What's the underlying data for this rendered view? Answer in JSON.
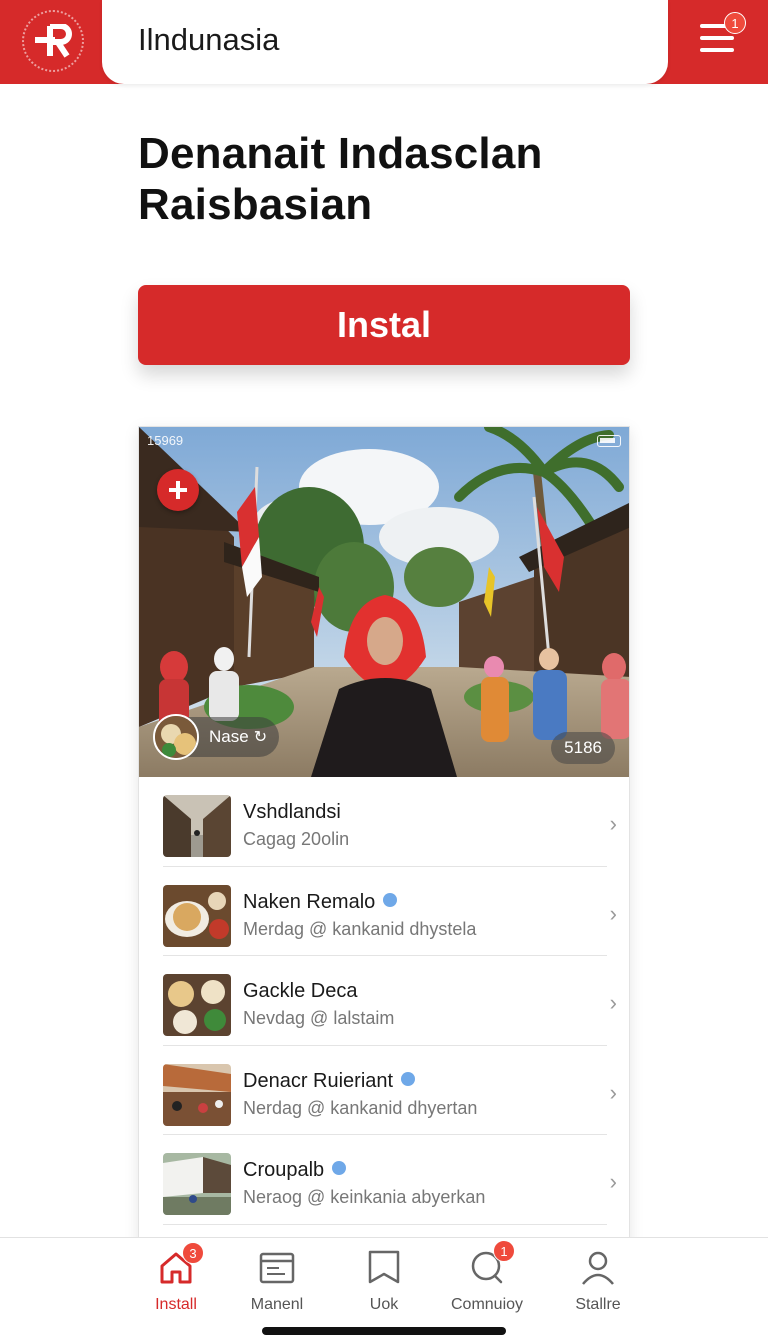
{
  "header": {
    "logo_icon": "brand-r-logo-icon",
    "search_text": "Ilndunasia",
    "menu_icon": "hamburger-menu-icon",
    "menu_badge": "1"
  },
  "hero": {
    "title_line1": "Denanait Indasclan",
    "title_line2": "Raisbasian",
    "install_label": "Instal"
  },
  "preview": {
    "status_left": "15969",
    "place_label": "Nase",
    "count": "5186"
  },
  "list": [
    {
      "title": "Vshdlandsi",
      "subtitle": "Cagag 20olin",
      "verified": false
    },
    {
      "title": "Naken Remalo",
      "subtitle": "Merdag @ kankanid dhystela",
      "verified": true
    },
    {
      "title": "Gackle Deca",
      "subtitle": "Nevdag @ lalstaim",
      "verified": false
    },
    {
      "title": "Denacr Ruieriant",
      "subtitle": "Nerdag @ kankanid dhyertan",
      "verified": true
    },
    {
      "title": "Croupalb",
      "subtitle": "Neraog @ keinkania abyerkan",
      "verified": true
    }
  ],
  "bottom_nav": [
    {
      "label": "Install",
      "icon": "home-icon",
      "badge": "3",
      "active": true
    },
    {
      "label": "Manenl",
      "icon": "browser-icon",
      "badge": "",
      "active": false
    },
    {
      "label": "Uok",
      "icon": "bookmark-icon",
      "badge": "",
      "active": false
    },
    {
      "label": "Comnuioy",
      "icon": "chat-icon",
      "badge": "1",
      "active": false
    },
    {
      "label": "Stallre",
      "icon": "profile-icon",
      "badge": "",
      "active": false
    }
  ],
  "colors": {
    "brand_red": "#d62a2a",
    "badge_red": "#ef4a3c",
    "verified_blue": "#6fa8e8"
  }
}
